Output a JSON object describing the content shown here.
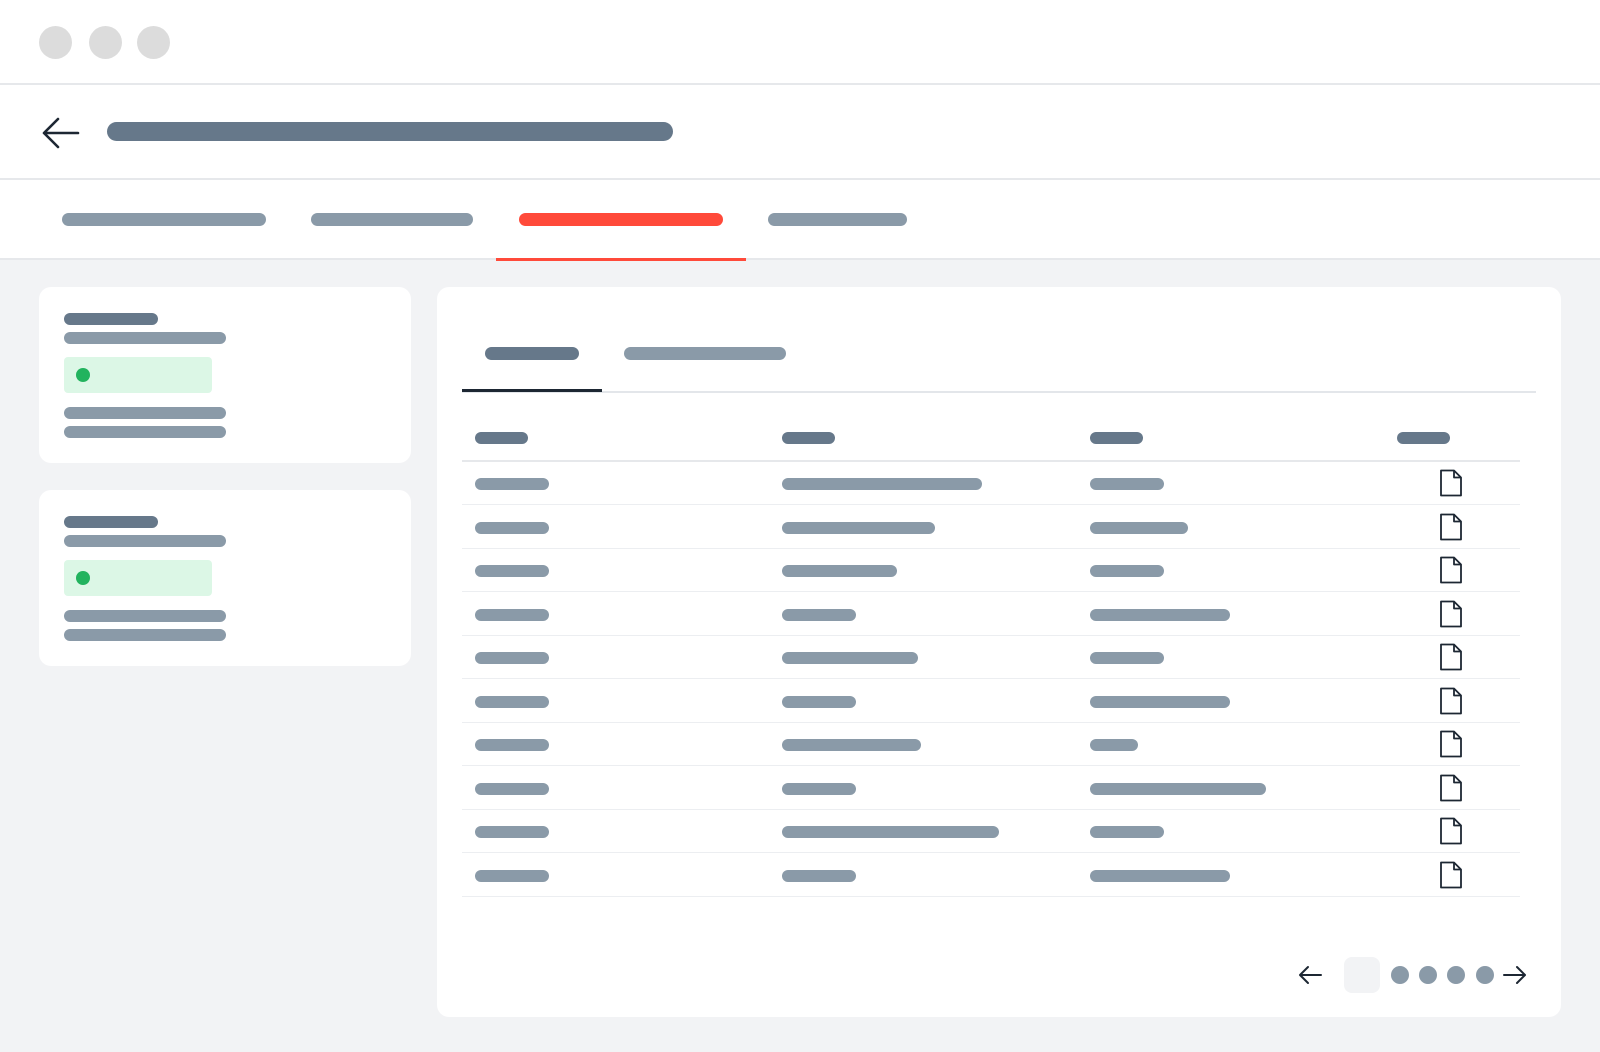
{
  "window": {
    "controls": [
      "window-dot",
      "window-dot",
      "window-dot"
    ]
  },
  "header": {
    "back_icon": "arrow-left-icon",
    "title_placeholder": "redacted-title"
  },
  "tabs": {
    "count": 4,
    "active_index": 2,
    "active_color": "#ff4a3a"
  },
  "cards": [
    {
      "status_color": "#22b35e",
      "status_bg": "#dcf7e6"
    },
    {
      "status_color": "#22b35e",
      "status_bg": "#dcf7e6"
    }
  ],
  "panel": {
    "subtabs_count": 2,
    "active_subtab_index": 0,
    "table": {
      "columns": 4,
      "rows": 10,
      "row_icon": "document-icon"
    },
    "pagination": {
      "prev_icon": "arrow-left-icon",
      "next_icon": "arrow-right-icon",
      "current_page": 1,
      "pages": 5
    }
  },
  "colors": {
    "text_placeholder_dark": "#66788a",
    "text_placeholder_light": "#8a9aa8",
    "background": "#f2f3f5"
  }
}
